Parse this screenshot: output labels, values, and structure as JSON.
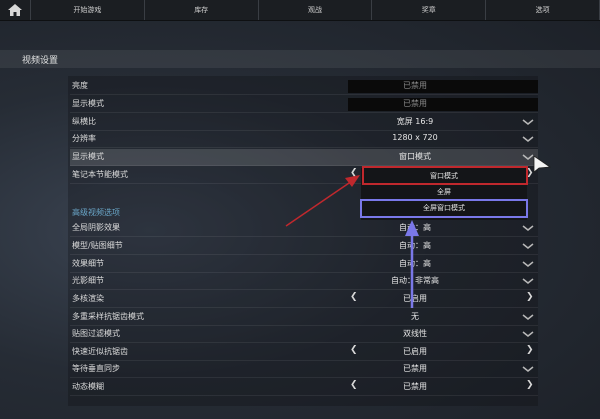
{
  "nav": {
    "tabs": [
      "开始游戏",
      "库存",
      "观战",
      "奖章",
      "选项"
    ]
  },
  "section": {
    "title": "视频设置"
  },
  "rows": [
    {
      "label": "亮度",
      "value": "已禁用",
      "kind": "boxed",
      "top": 0
    },
    {
      "label": "显示模式",
      "value": "已禁用",
      "kind": "boxed"
    },
    {
      "label": "纵横比",
      "value": "宽屏 16:9",
      "kind": "dropdown"
    },
    {
      "label": "分辨率",
      "value": "1280 x 720",
      "kind": "dropdown"
    },
    {
      "label": "显示模式",
      "value": "窗口模式",
      "kind": "dropdown"
    },
    {
      "label": "笔记本节能模式",
      "value": "",
      "kind": "arrows"
    }
  ],
  "advanced": {
    "title": "高级视频选项",
    "rows": [
      {
        "label": "全局阴影效果",
        "value": "自动：高",
        "kind": "dropdown"
      },
      {
        "label": "模型/贴图细节",
        "value": "自动：高",
        "kind": "dropdown"
      },
      {
        "label": "效果细节",
        "value": "自动：高",
        "kind": "dropdown"
      },
      {
        "label": "光影细节",
        "value": "自动：非常高",
        "kind": "dropdown"
      },
      {
        "label": "多核渲染",
        "value": "已启用",
        "kind": "arrows"
      },
      {
        "label": "多重采样抗锯齿模式",
        "value": "无",
        "kind": "dropdown"
      },
      {
        "label": "贴图过滤模式",
        "value": "双线性",
        "kind": "dropdown"
      },
      {
        "label": "快速近似抗锯齿",
        "value": "已启用",
        "kind": "arrows"
      },
      {
        "label": "等待垂直同步",
        "value": "已禁用",
        "kind": "dropdown"
      },
      {
        "label": "动态模糊",
        "value": "已禁用",
        "kind": "arrows"
      }
    ]
  },
  "dropdown_options": [
    "窗口模式",
    "全屏",
    "全屏窗口模式"
  ],
  "icons": {
    "home": "home-icon",
    "chevron": "chevron-down-icon",
    "arrow_left": "arrow-left-icon",
    "arrow_right": "arrow-right-icon"
  },
  "colors": {
    "annotation_red": "#c0282d",
    "annotation_blue": "#7a78e8",
    "accent_blue": "#6aa6c8"
  }
}
